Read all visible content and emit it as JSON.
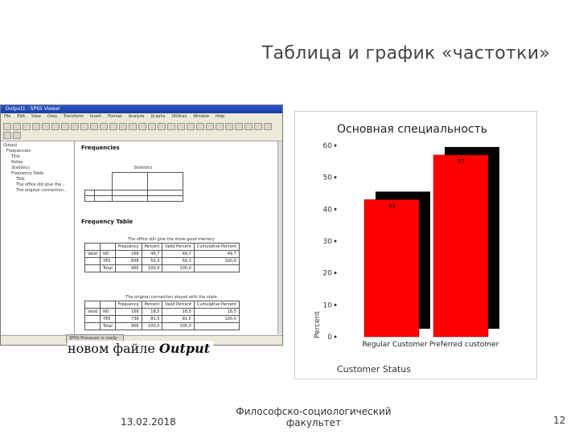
{
  "slide": {
    "title": "Таблица и график «частотки»",
    "caption_prefix": "новом файле",
    "caption_bold": "Output",
    "footer": {
      "date": "13.02.2018",
      "faculty": "Философско-социологический факультет",
      "page": "12"
    }
  },
  "spss_window": {
    "title": "Output1 - SPSS Viewer",
    "menu": [
      "File",
      "Edit",
      "View",
      "Data",
      "Transform",
      "Insert",
      "Format",
      "Analyze",
      "Graphs",
      "Utilities",
      "Window",
      "Help"
    ],
    "outline": [
      {
        "label": "Output",
        "level": 0
      },
      {
        "label": "Frequencies",
        "level": 1
      },
      {
        "label": "Title",
        "level": 2
      },
      {
        "label": "Notes",
        "level": 2
      },
      {
        "label": "Statistics",
        "level": 2
      },
      {
        "label": "Frequency Table",
        "level": 2
      },
      {
        "label": "Title",
        "level": 3
      },
      {
        "label": "The office did give the...",
        "level": 3
      },
      {
        "label": "The original connection...",
        "level": 3
      }
    ],
    "frequencies_heading": "Frequencies",
    "statistics_caption": "Statistics",
    "frequency_table_heading": "Frequency Table",
    "table1_caption": "The office still give the show good memory",
    "table1": {
      "headers": [
        "",
        "",
        "Frequency",
        "Percent",
        "Valid Percent",
        "Cumulative Percent"
      ],
      "rows": [
        [
          "Valid",
          "NO",
          "168",
          "49,7",
          "49,7",
          "49,7"
        ],
        [
          "",
          "YES",
          "858",
          "50,3",
          "50,3",
          "100,0"
        ],
        [
          "",
          "Total",
          "966",
          "100,0",
          "100,0",
          ""
        ]
      ]
    },
    "table2_caption": "The original connection stayed with the state",
    "table2": {
      "headers": [
        "",
        "",
        "Frequency",
        "Percent",
        "Valid Percent",
        "Cumulative Percent"
      ],
      "rows": [
        [
          "Valid",
          "NO",
          "168",
          "18,5",
          "18,5",
          "18,5"
        ],
        [
          "",
          "YES",
          "738",
          "81,5",
          "81,5",
          "100,0"
        ],
        [
          "",
          "Total",
          "906",
          "100,0",
          "100,0",
          ""
        ]
      ]
    },
    "taskbar_label": "SPSS Processor is ready"
  },
  "chart_data": {
    "type": "bar",
    "title": "Основная специальность",
    "categories": [
      "Regular Customer",
      "Preferred customer"
    ],
    "values": [
      43,
      57
    ],
    "xlabel": "Customer Status",
    "ylabel": "Percent",
    "ylim": [
      0,
      60
    ],
    "yticks": [
      0,
      10,
      20,
      30,
      40,
      50,
      60
    ],
    "grid": false,
    "style": "3d-shadow",
    "colors": {
      "bar": "#ff0000",
      "shadow": "#000000"
    }
  }
}
